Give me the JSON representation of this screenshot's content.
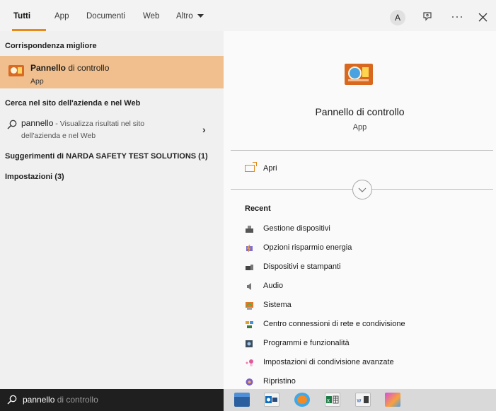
{
  "tabs": [
    {
      "label": "Tutti",
      "active": true
    },
    {
      "label": "App"
    },
    {
      "label": "Documenti"
    },
    {
      "label": "Web"
    },
    {
      "label": "Altro"
    }
  ],
  "toolbar": {
    "account_initial": "A",
    "feedback_icon": "feedback-icon",
    "more_icon": "more-icon",
    "close_icon": "close-icon"
  },
  "left": {
    "best_match_header": "Corrispondenza migliore",
    "best_match": {
      "title_bold": "Pannello",
      "title_rest": " di controllo",
      "type": "App",
      "icon": "control-panel-icon"
    },
    "web_header": "Cerca nel sito dell'azienda e nel Web",
    "web_result": {
      "query": "pannello",
      "description_line1": " - Visualizza risultati nel sito",
      "description_line2": "dell'azienda e nel Web"
    },
    "suggestions_header": "Suggerimenti di NARDA SAFETY TEST SOLUTIONS (1)",
    "settings_header": "Impostazioni (3)"
  },
  "right": {
    "app_name": "Pannello di controllo",
    "app_type": "App",
    "open_label": "Apri",
    "recent_header": "Recent",
    "recent_items": [
      {
        "label": "Gestione dispositivi",
        "icon": "device-manager-icon"
      },
      {
        "label": "Opzioni risparmio energia",
        "icon": "power-options-icon"
      },
      {
        "label": "Dispositivi e stampanti",
        "icon": "devices-printers-icon"
      },
      {
        "label": "Audio",
        "icon": "audio-icon"
      },
      {
        "label": "Sistema",
        "icon": "system-icon"
      },
      {
        "label": "Centro connessioni di rete e condivisione",
        "icon": "network-center-icon"
      },
      {
        "label": "Programmi e funzionalità",
        "icon": "programs-icon"
      },
      {
        "label": "Impostazioni di condivisione avanzate",
        "icon": "sharing-settings-icon"
      },
      {
        "label": "Ripristino",
        "icon": "recovery-icon"
      }
    ]
  },
  "searchbox": {
    "typed": "pannello",
    "completion": " di controllo"
  },
  "taskbar": [
    "file-explorer-icon",
    "outlook-icon",
    "edge-icon",
    "excel-icon",
    "word-icon",
    "app-icon"
  ]
}
